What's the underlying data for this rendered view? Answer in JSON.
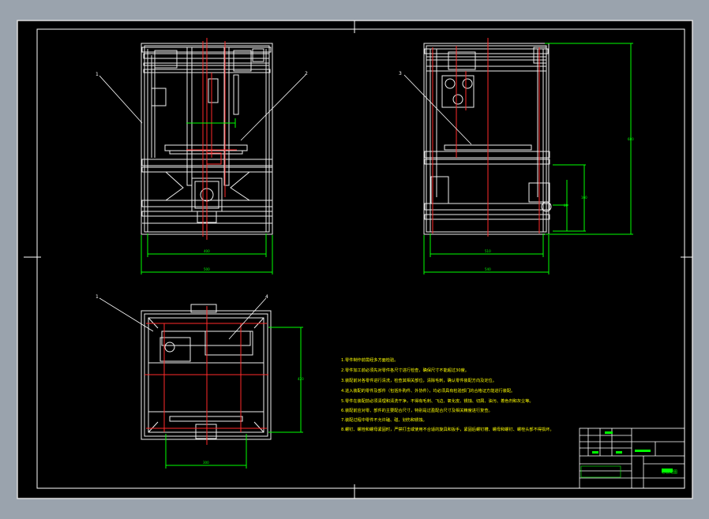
{
  "drawing": {
    "callouts": {
      "front_left": "1",
      "front_right": "2",
      "side": "3",
      "top_left": "1",
      "top_right": "4"
    },
    "dims": {
      "front_inner_width": "400",
      "front_outer_width": "500",
      "side_inner_width": "510",
      "side_outer_width": "540",
      "side_height": "680",
      "side_small_a": "160",
      "side_small_b": "80",
      "top_height": "420",
      "top_width": "300"
    },
    "notes": [
      "1.零件制作前需经多方面检验。",
      "2.零件加工前必须先对零件各尺寸进行检查，确保尺寸不能超过30度。",
      "3.装配前对各零件进行清洗，检查其相关部位，清除毛刺，确认零件装配方向及定位。",
      "4.进入装配的零件及部件（包括外购件、外协件），均必须具有检验部门的合格证方能进行装配。",
      "5.零件在装配前必须清理和清洗干净，不得有毛刺、飞边、氧化皮、锈蚀、切屑、油污、着色剂和灰尘等。",
      "6.装配前应对零、部件的主要配合尺寸，特别是过盈配合尺寸及相关精度进行复查。",
      "7.装配过程中零件不允许磕、碰、划伤和锈蚀。",
      "8.螺钉、螺栓和螺母紧固时，严禁打击或使用不合适的旋具和扳手，紧固后螺钉槽、螺母和螺钉、螺栓头部不得损坏。"
    ],
    "title_block": {
      "drawing_name": "总装配图"
    },
    "colors": {
      "background": "#000000",
      "frame": "#ffffff",
      "dimension": "#00ff00",
      "centerline": "#ff2a2a",
      "note_text": "#ffff00",
      "outer_bg": "#9aa3ad"
    }
  }
}
